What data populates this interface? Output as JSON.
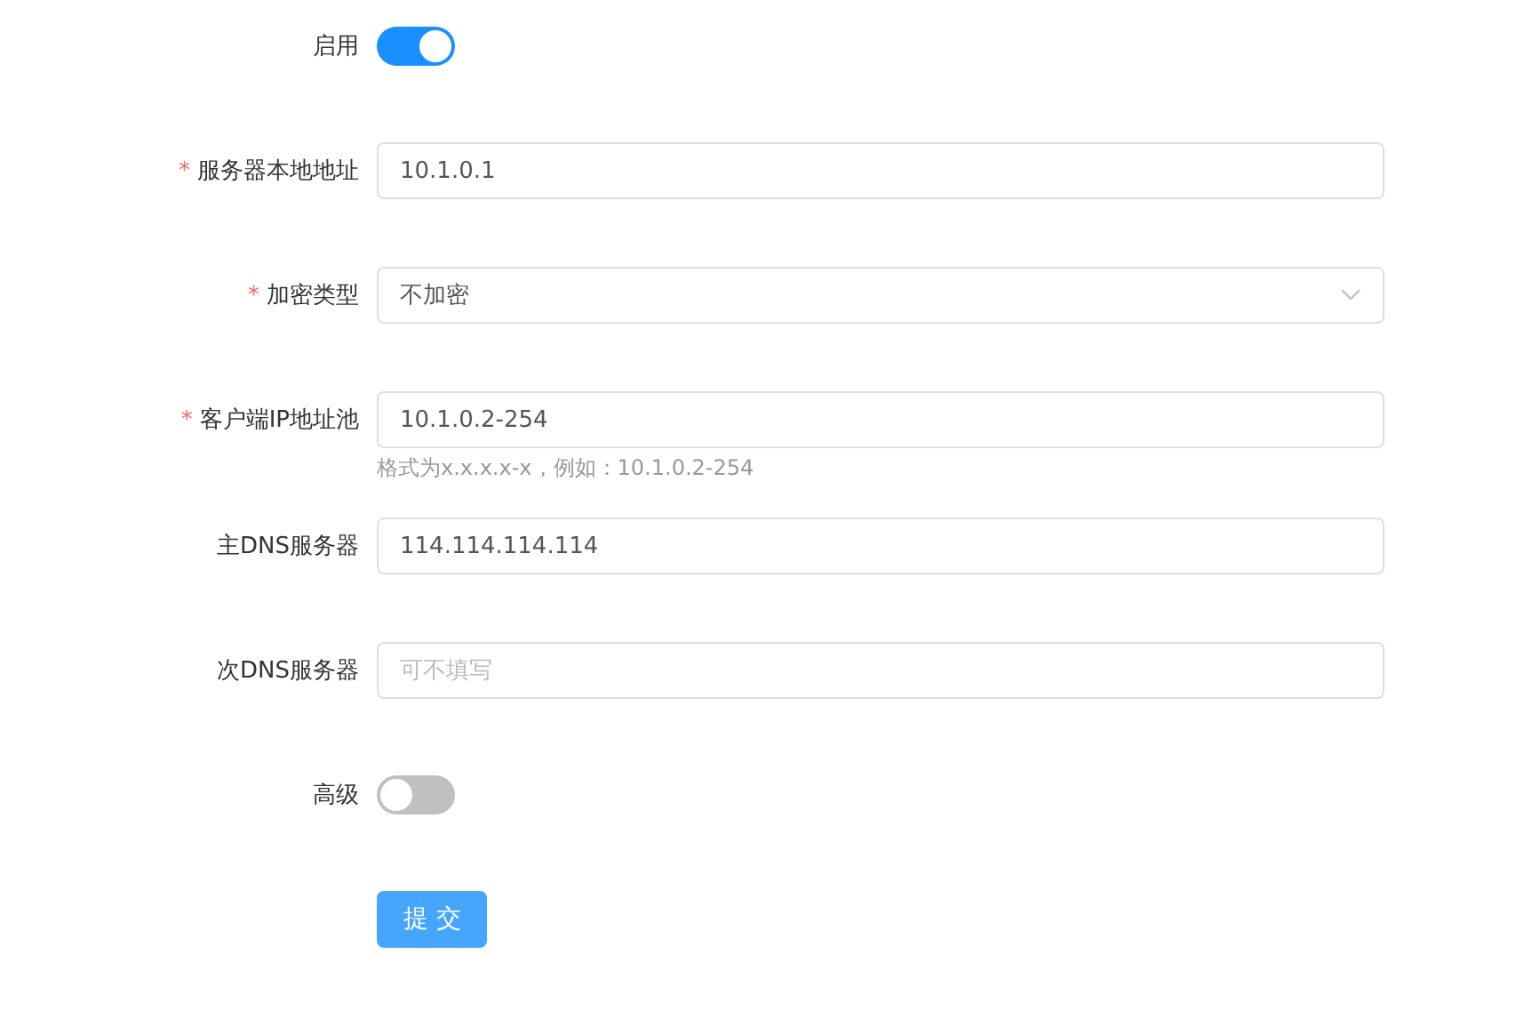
{
  "fields": [
    {
      "kind": "switch",
      "label": "启用",
      "required": false,
      "on": true
    },
    {
      "kind": "input",
      "label": "服务器本地地址",
      "required": true,
      "value": "10.1.0.1"
    },
    {
      "kind": "select",
      "label": "加密类型",
      "required": true,
      "value": "不加密"
    },
    {
      "kind": "input",
      "label": "客户端IP地址池",
      "required": true,
      "value": "10.1.0.2-254",
      "hint": "格式为x.x.x.x-x，例如：10.1.0.2-254"
    },
    {
      "kind": "input",
      "label": "主DNS服务器",
      "required": false,
      "value": "114.114.114.114"
    },
    {
      "kind": "input",
      "label": "次DNS服务器",
      "required": false,
      "placeholder": "可不填写"
    },
    {
      "kind": "switch",
      "label": "高级",
      "required": false,
      "on": false
    }
  ],
  "required_mark": "*",
  "submit_button": "提 交"
}
